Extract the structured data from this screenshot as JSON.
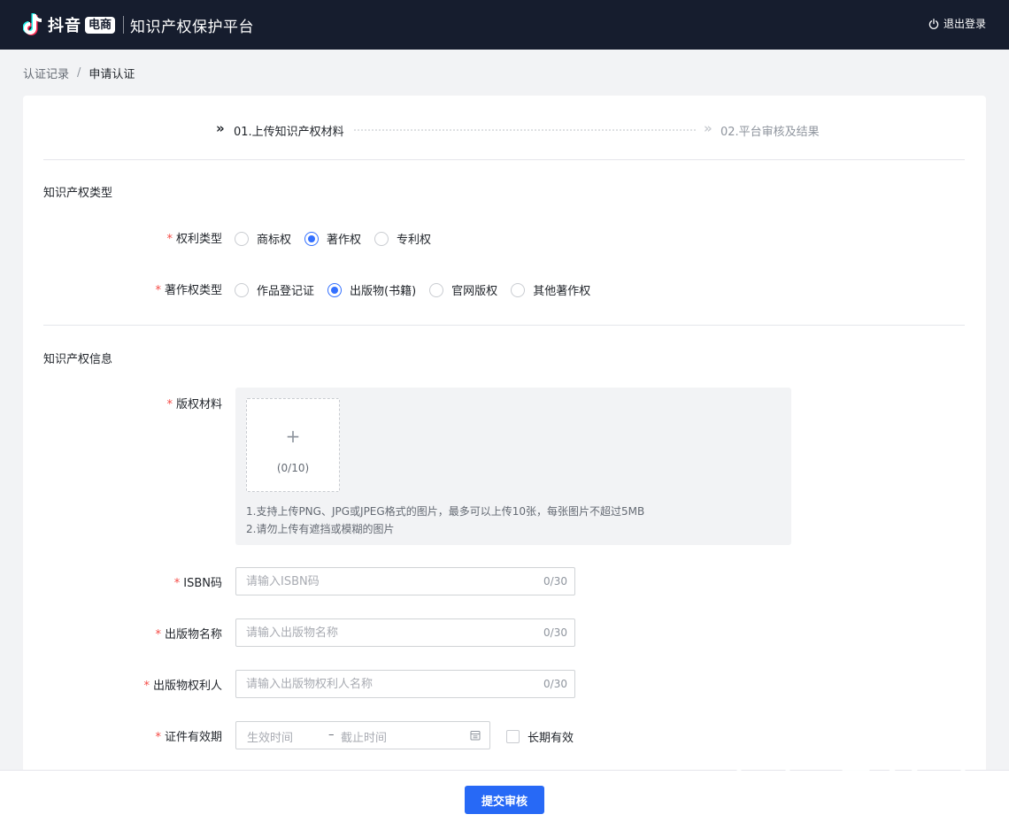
{
  "header": {
    "brand": "抖音",
    "brand_badge": "电商",
    "platform_title": "知识产权保护平台",
    "logout_label": "退出登录"
  },
  "breadcrumb": {
    "parent": "认证记录",
    "separator": "/",
    "current": "申请认证"
  },
  "steps": {
    "step1": "01.上传知识产权材料",
    "step2": "02.平台审核及结果",
    "arrow": "»"
  },
  "section1": {
    "title": "知识产权类型",
    "right_type": {
      "label": "权利类型",
      "required": "*",
      "options": [
        "商标权",
        "著作权",
        "专利权"
      ],
      "selected": "著作权"
    },
    "copyright_type": {
      "label": "著作权类型",
      "required": "*",
      "options": [
        "作品登记证",
        "出版物(书籍)",
        "官网版权",
        "其他著作权"
      ],
      "selected": "出版物(书籍)"
    }
  },
  "section2": {
    "title": "知识产权信息",
    "material": {
      "label": "版权材料",
      "required": "*",
      "plus": "+",
      "count": "(0/10)",
      "tip1": "1.支持上传PNG、JPG或JPEG格式的图片，最多可以上传10张，每张图片不超过5MB",
      "tip2": "2.请勿上传有遮挡或模糊的图片"
    },
    "isbn": {
      "label": "ISBN码",
      "required": "*",
      "placeholder": "请输入ISBN码",
      "value": "",
      "count": "0/30"
    },
    "pub_name": {
      "label": "出版物名称",
      "required": "*",
      "placeholder": "请输入出版物名称",
      "value": "",
      "count": "0/30"
    },
    "pub_owner": {
      "label": "出版物权利人",
      "required": "*",
      "placeholder": "请输入出版物权利人名称",
      "value": "",
      "count": "0/30"
    },
    "validity": {
      "label": "证件有效期",
      "required": "*",
      "start_placeholder": "生效时间",
      "separator": "–",
      "end_placeholder": "截止时间",
      "long_term_label": "长期有效",
      "long_term_checked": false
    }
  },
  "footer": {
    "submit_label": "提交审核"
  },
  "colors": {
    "accent": "#3370ff",
    "button": "#2769f6",
    "topbar": "#161d2e",
    "required": "#f54a45"
  },
  "icons": {
    "logo": "douyin-note-icon",
    "logout": "power-icon",
    "calendar": "calendar-icon",
    "watermark": "电商运营官"
  }
}
